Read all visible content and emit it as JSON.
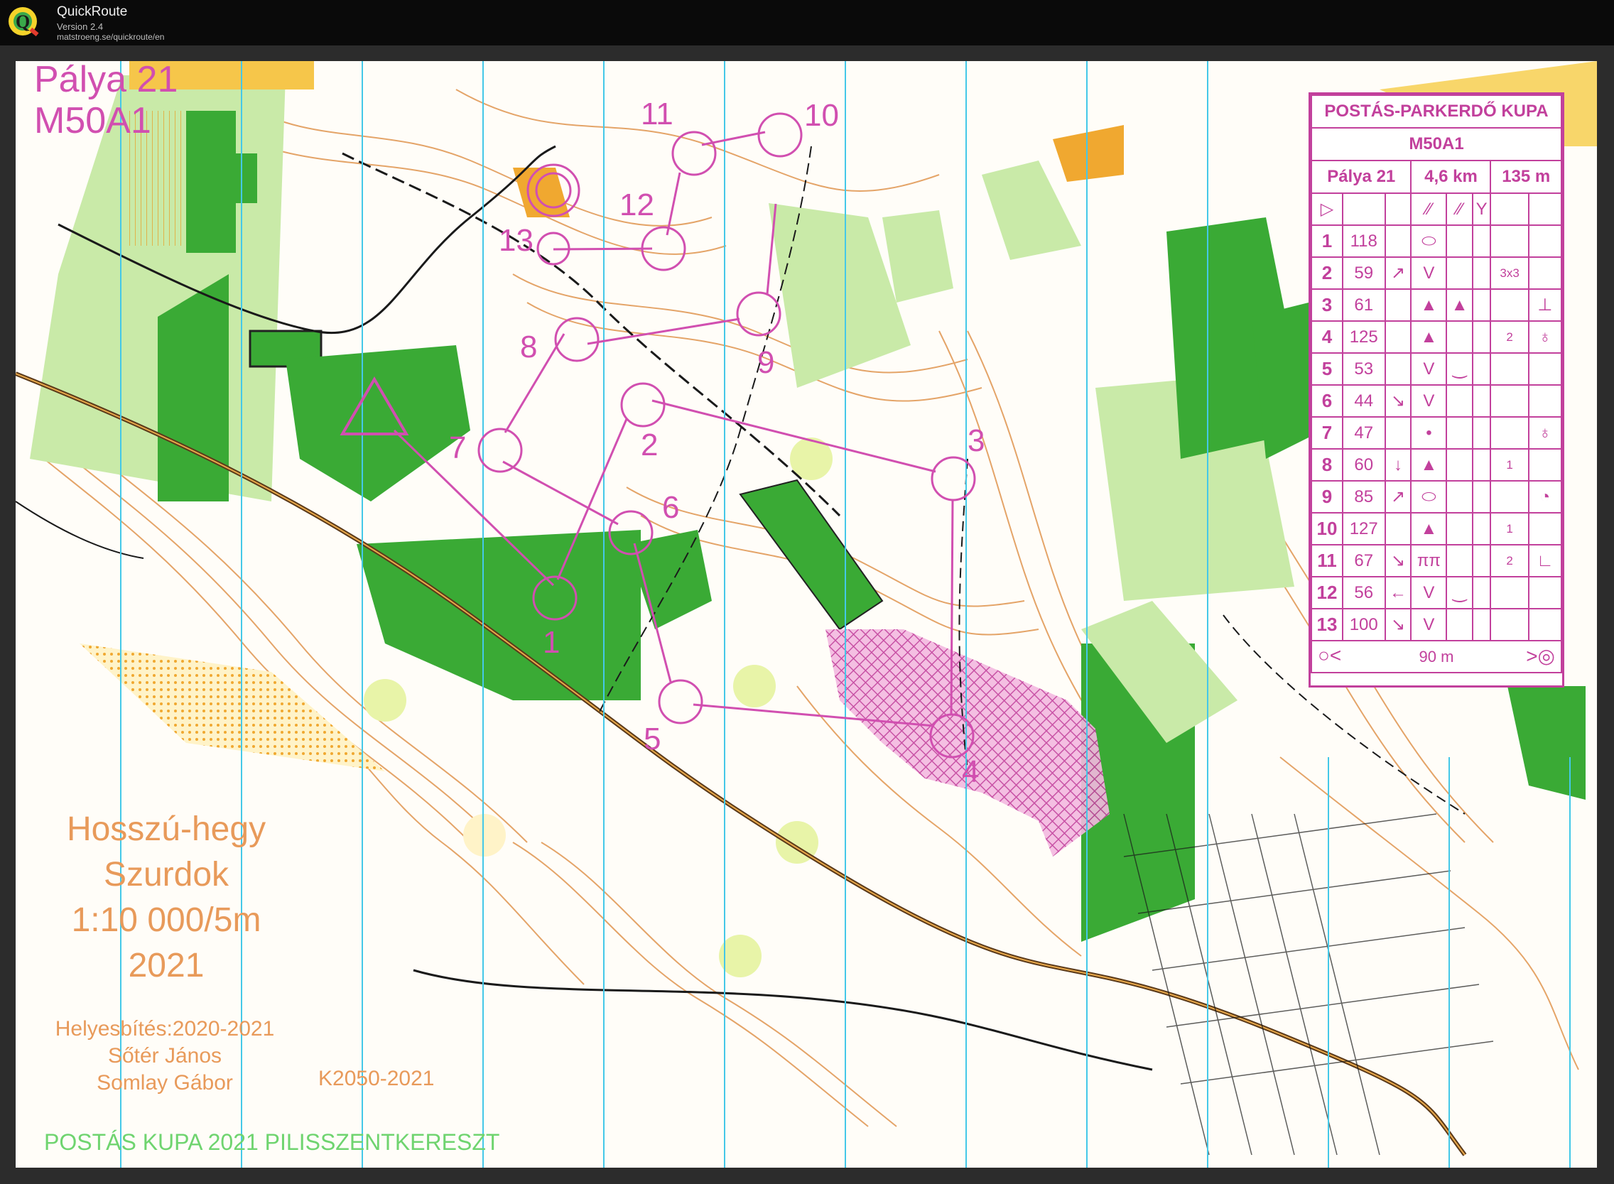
{
  "titlebar": {
    "app_name": "QuickRoute",
    "version": "Version 2.4",
    "url": "matstroeng.se/quickroute/en"
  },
  "map": {
    "course_title_line1": "Pálya 21",
    "course_title_line2": "M50A1",
    "map_name_line1": "Hosszú-hegy",
    "map_name_line2": "Szurdok",
    "scale_line": "1:10 000/5m",
    "year": "2021",
    "update_line": "Helyesbítés:2020-2021",
    "author1": "Sőtér János",
    "author2": "Somlay Gábor",
    "permit": "K2050-2021",
    "event_name": "POSTÁS KUPA 2021 PILISSZENTKERESZT",
    "colors": {
      "course": "#d14fb0",
      "forest_dark": "#3aaa35",
      "forest_light": "#c9eaa8",
      "contour": "#e0954f",
      "magnetic_north": "#44c8e8"
    }
  },
  "course": {
    "controls": [
      {
        "number": "1"
      },
      {
        "number": "2"
      },
      {
        "number": "3"
      },
      {
        "number": "4"
      },
      {
        "number": "5"
      },
      {
        "number": "6"
      },
      {
        "number": "7"
      },
      {
        "number": "8"
      },
      {
        "number": "9"
      },
      {
        "number": "10"
      },
      {
        "number": "11"
      },
      {
        "number": "12"
      },
      {
        "number": "13"
      }
    ]
  },
  "description_sheet": {
    "event": "POSTÁS-PARKERDŐ KUPA",
    "class": "M50A1",
    "course": "Pálya 21",
    "length": "4,6 km",
    "climb": "135 m",
    "start_symbol": "▷",
    "finish_distance": "90 m",
    "rows": [
      {
        "num": "1",
        "code": "118",
        "dir": "",
        "feat": "⬭",
        "feat2": "",
        "dim": "",
        "extra": ""
      },
      {
        "num": "2",
        "code": "59",
        "dir": "↗",
        "feat": "V",
        "feat2": "",
        "dim": "3x3",
        "extra": ""
      },
      {
        "num": "3",
        "code": "61",
        "dir": "",
        "feat": "▲",
        "feat2": "▲",
        "dim": "",
        "extra": "⊥"
      },
      {
        "num": "4",
        "code": "125",
        "dir": "",
        "feat": "▲",
        "feat2": "",
        "dim": "2",
        "extra": "♁"
      },
      {
        "num": "5",
        "code": "53",
        "dir": "",
        "feat": "V",
        "feat2": "‿",
        "dim": "",
        "extra": ""
      },
      {
        "num": "6",
        "code": "44",
        "dir": "↘",
        "feat": "V",
        "feat2": "",
        "dim": "",
        "extra": ""
      },
      {
        "num": "7",
        "code": "47",
        "dir": "",
        "feat": "•",
        "feat2": "",
        "dim": "",
        "extra": "♁"
      },
      {
        "num": "8",
        "code": "60",
        "dir": "↓",
        "feat": "▲",
        "feat2": "",
        "dim": "1",
        "extra": ""
      },
      {
        "num": "9",
        "code": "85",
        "dir": "↗",
        "feat": "⬭",
        "feat2": "",
        "dim": "",
        "extra": "◔"
      },
      {
        "num": "10",
        "code": "127",
        "dir": "",
        "feat": "▲",
        "feat2": "",
        "dim": "1",
        "extra": ""
      },
      {
        "num": "11",
        "code": "67",
        "dir": "↘",
        "feat": "ππ",
        "feat2": "",
        "dim": "2",
        "extra": "∟"
      },
      {
        "num": "12",
        "code": "56",
        "dir": "←",
        "feat": "V",
        "feat2": "‿",
        "dim": "",
        "extra": ""
      },
      {
        "num": "13",
        "code": "100",
        "dir": "↘",
        "feat": "V",
        "feat2": "",
        "dim": "",
        "extra": ""
      }
    ]
  }
}
